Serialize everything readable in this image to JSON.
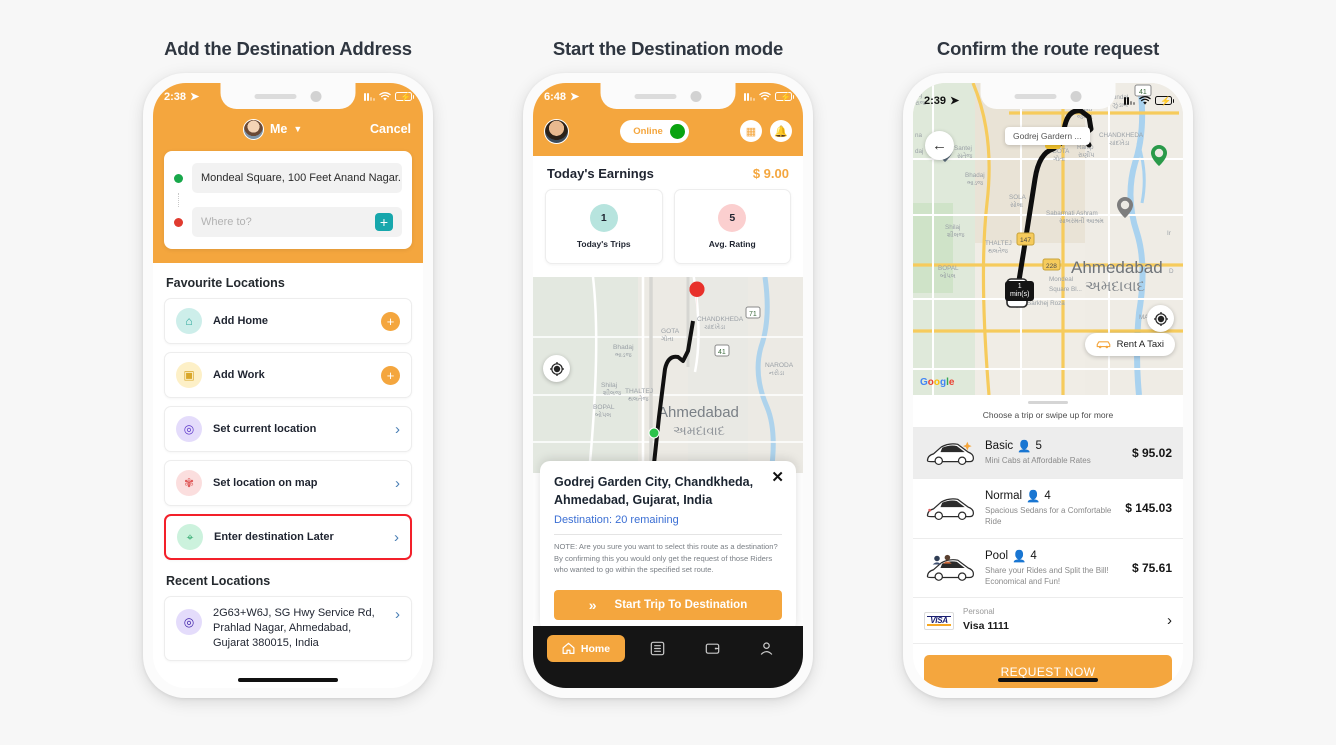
{
  "theme": {
    "accent": "#f4a63e",
    "page_bg": "#f7f7f7",
    "danger": "#f3202a",
    "link": "#3b6fd4",
    "teal": "#17a7ac"
  },
  "columns": [
    {
      "title": "Add the Destination Address"
    },
    {
      "title": "Start the Destination mode"
    },
    {
      "title": "Confirm the route request"
    }
  ],
  "phone1": {
    "status": {
      "time": "2:38"
    },
    "header": {
      "profile_name": "Me",
      "cancel_label": "Cancel"
    },
    "address": {
      "pickup_value": "Mondeal Square, 100 Feet Anand Nagar...",
      "destination_placeholder": "Where to?"
    },
    "favourite_title": "Favourite Locations",
    "favourites": [
      {
        "label": "Add Home",
        "icon": "home-icon",
        "icon_bg": "#cdeeea",
        "icon_color": "#2aa79b",
        "action": "plus"
      },
      {
        "label": "Add Work",
        "icon": "briefcase-icon",
        "icon_bg": "#fdf0c7",
        "icon_color": "#e0ae2e",
        "action": "plus"
      },
      {
        "label": "Set current location",
        "icon": "location-pin-icon",
        "icon_bg": "#e4dcfb",
        "icon_color": "#5b35c9",
        "action": "chevron"
      },
      {
        "label": "Set location on map",
        "icon": "map-pin-icon",
        "icon_bg": "#fbdede",
        "icon_color": "#e05b5b",
        "action": "chevron"
      },
      {
        "label": "Enter destination Later",
        "icon": "later-pin-icon",
        "icon_bg": "#ccf2dd",
        "icon_color": "#2aa76a",
        "action": "chevron",
        "highlighted": true
      }
    ],
    "recent_title": "Recent Locations",
    "recents": [
      {
        "label": "2G63+W6J, SG Hwy Service Rd, Prahlad Nagar, Ahmedabad, Gujarat 380015, India",
        "icon": "location-pin-icon",
        "icon_bg": "#e4dcfb",
        "icon_color": "#3d1fa8"
      }
    ]
  },
  "phone2": {
    "status": {
      "time": "6:48"
    },
    "header": {
      "online_label": "Online",
      "calendar_icon": "calendar-icon",
      "bell_icon": "bell-icon"
    },
    "earnings": {
      "label": "Today's Earnings",
      "amount": "$ 9.00"
    },
    "stats": [
      {
        "value": "1",
        "label": "Today's Trips",
        "color": "#b7e4de"
      },
      {
        "value": "5",
        "label": "Avg. Rating",
        "color": "#fbcfcf"
      }
    ],
    "map": {
      "labels": [
        "CHANDKHEDA",
        "GOTA",
        "Bhadaj",
        "Shilaj",
        "THALTEJ",
        "BOPAL",
        "NARODA",
        "Ahmedabad"
      ]
    },
    "sheet": {
      "title": "Godrej Garden City, Chandkheda, Ahmedabad, Gujarat, India",
      "destination_status": "Destination: 20 remaining",
      "note": "NOTE: Are you sure you want to select this route as a destination? By confirming this you would only get the request of those Riders who wanted to go within the specified set route.",
      "cta": "Start Trip To Destination"
    },
    "tabs": [
      {
        "label": "Home",
        "icon": "home-icon",
        "active": true
      },
      {
        "label": "",
        "icon": "list-icon",
        "active": false
      },
      {
        "label": "",
        "icon": "wallet-icon",
        "active": false
      },
      {
        "label": "",
        "icon": "person-icon",
        "active": false
      }
    ]
  },
  "phone3": {
    "status": {
      "time": "2:39"
    },
    "map": {
      "search_chip": "Godrej Gardern ...",
      "rent_pill": "Rent A Taxi",
      "eta_value": "1",
      "eta_unit": "min(s)",
      "google_label": "Google",
      "labels": [
        "Zundal",
        "Jagad",
        "CHANDKHEDA",
        "Santej",
        "GOTA",
        "Ranip",
        "Bhadaj",
        "SOLA",
        "Sabarmati Ashram",
        "Shilaj",
        "THALTEJ",
        "BOPAL",
        "Mondeal Square Bl...",
        "Sarkhej Roza",
        "Ahmedabad",
        "MANINAG"
      ]
    },
    "hint": "Choose a trip or swipe up for more",
    "rides": [
      {
        "name": "Basic",
        "seats": "5",
        "desc": "Mini Cabs at Affordable Rates",
        "price": "$ 95.02",
        "selected": true
      },
      {
        "name": "Normal",
        "seats": "4",
        "desc": "Spacious Sedans for a Comfortable Ride",
        "price": "$ 145.03",
        "selected": false
      },
      {
        "name": "Pool",
        "seats": "4",
        "desc": "Share your Rides and Split the Bill! Economical and Fun!",
        "price": "$ 75.61",
        "selected": false
      }
    ],
    "payment": {
      "type": "Personal",
      "card": "Visa 1111",
      "brand": "VISA"
    },
    "request_button": "REQUEST NOW"
  }
}
